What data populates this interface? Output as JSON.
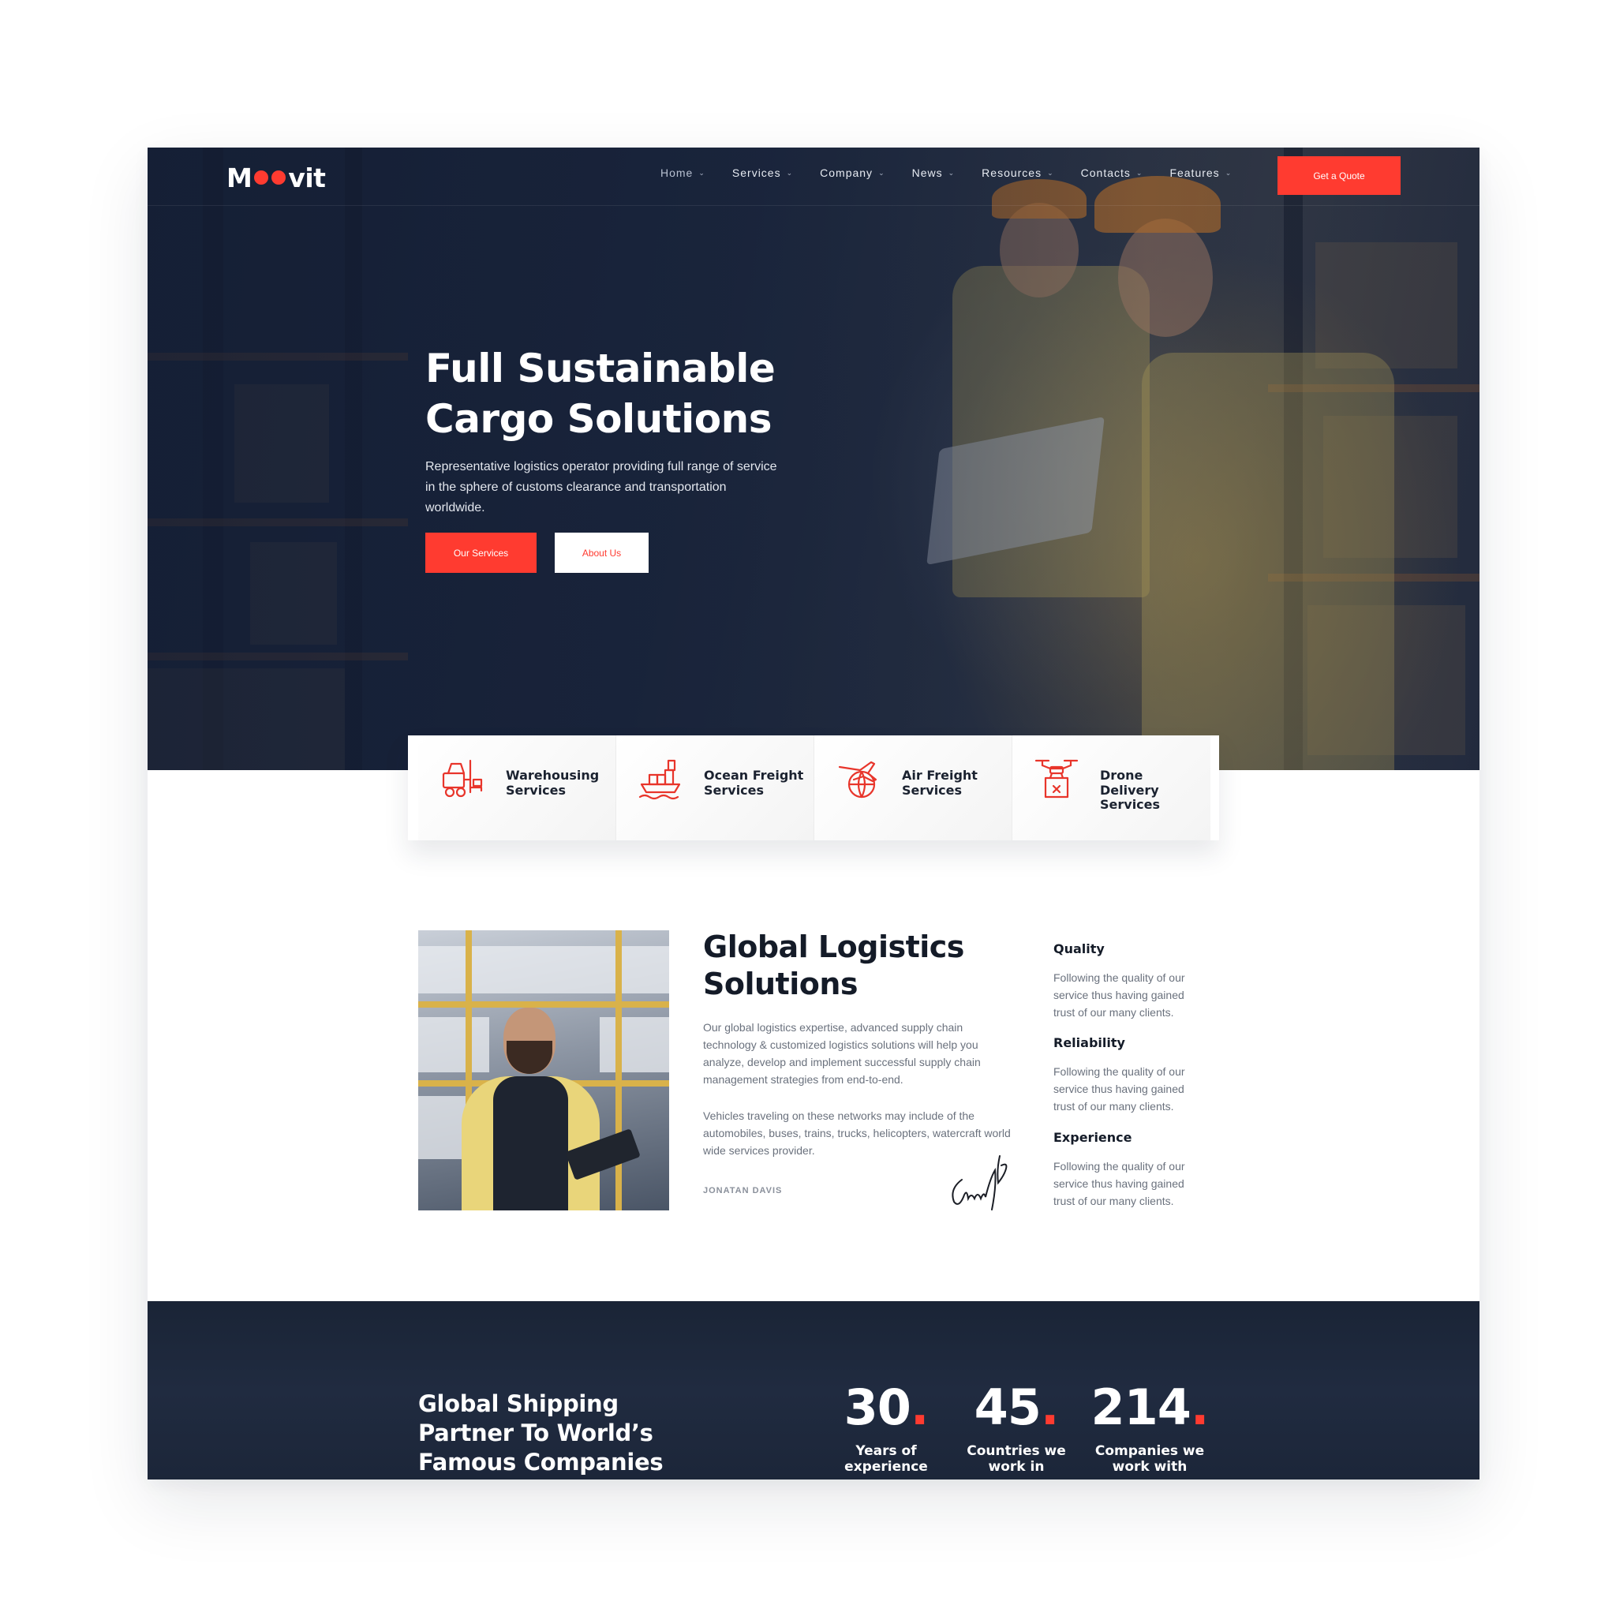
{
  "brand": {
    "name_start": "M",
    "name_end": "vit",
    "accent": "#ff3b30",
    "dark": "#1b2436"
  },
  "nav": {
    "items": [
      {
        "label": "Home"
      },
      {
        "label": "Services"
      },
      {
        "label": "Company"
      },
      {
        "label": "News"
      },
      {
        "label": "Resources"
      },
      {
        "label": "Contacts"
      },
      {
        "label": "Features"
      }
    ],
    "chevron_icon": "chevron-down-icon",
    "cta": "Get a Quote"
  },
  "hero": {
    "title": "Full Sustainable Cargo Solutions",
    "text": "Representative logistics operator providing full range of service in the sphere of customs clearance and transportation worldwide.",
    "primary_btn": "Our Services",
    "secondary_btn": "About Us"
  },
  "services": [
    {
      "label": "Warehousing Services",
      "icon": "forklift-icon"
    },
    {
      "label": "Ocean Freight Services",
      "icon": "ship-icon"
    },
    {
      "label": "Air Freight Services",
      "icon": "airplane-globe-icon"
    },
    {
      "label": "Drone Delivery Services",
      "icon": "drone-icon"
    }
  ],
  "about": {
    "title": "Global Logistics Solutions",
    "p1": "Our global logistics expertise, advanced supply chain technology & customized logistics solutions will help you analyze, develop and implement successful supply chain management strategies from end-to-end.",
    "p2": "Vehicles traveling on these networks may include of the automobiles, buses, trains, trucks, helicopters, watercraft world wide services provider.",
    "author": "JONATAN DAVIS"
  },
  "features": [
    {
      "title": "Quality",
      "text": "Following the quality of our service thus having gained trust of our many clients."
    },
    {
      "title": "Reliability",
      "text": "Following the quality of our service thus having gained trust of our many clients."
    },
    {
      "title": "Experience",
      "text": "Following the quality of our service thus having gained trust of our many clients."
    }
  ],
  "stats": {
    "title": "Global Shipping Partner To World’s Famous Companies",
    "dot": ".",
    "items": [
      {
        "value": "30",
        "caption": "Years of experience"
      },
      {
        "value": "45",
        "caption": "Countries we work in"
      },
      {
        "value": "214",
        "caption": "Companies we work with"
      }
    ]
  }
}
